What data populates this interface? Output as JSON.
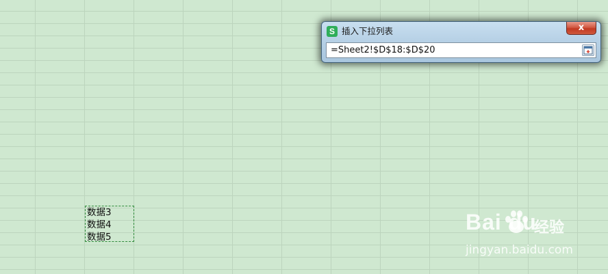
{
  "sheet": {
    "selected_cells": [
      "数据3",
      "数据4",
      "数据5"
    ]
  },
  "dialog": {
    "icon": "S",
    "title": "插入下拉列表",
    "close_label": "x",
    "range_value": "=Sheet2!$D$18:$D$20"
  },
  "watermark": {
    "logo_text": "Bai du",
    "suffix": "经验",
    "url": "jingyan.baidu.com"
  },
  "colors": {
    "sheet_background": "#cfe8d0",
    "selection_border": "#2f8a3a",
    "close_button": "#c23a22",
    "app_icon": "#2fae5a"
  }
}
